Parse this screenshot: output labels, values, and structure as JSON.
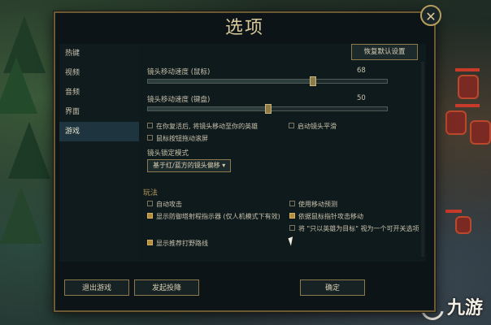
{
  "dialog": {
    "title": "选项",
    "close_symbol": "✕",
    "restore_defaults": "恢复默认设置"
  },
  "sidebar": {
    "items": [
      {
        "label": "热键",
        "active": false
      },
      {
        "label": "视频",
        "active": false
      },
      {
        "label": "音频",
        "active": false
      },
      {
        "label": "界面",
        "active": false
      },
      {
        "label": "游戏",
        "active": true
      }
    ]
  },
  "camera": {
    "mouse_speed": {
      "label": "镜头移动速度 (鼠标)",
      "value": "68"
    },
    "keyboard_speed": {
      "label": "镜头移动速度 (键盘)",
      "value": "50"
    },
    "options": [
      {
        "label": "在你复活后, 将镜头移动至你的英雄",
        "checked": false
      },
      {
        "label": "启动镜头平滑",
        "checked": false
      },
      {
        "label": "鼠标按钮拖动滚屏",
        "checked": false
      }
    ],
    "lock_mode_label": "镜头锁定模式",
    "lock_mode_value": "基于红/蓝方的镜头偏移",
    "lock_mode_caret": "▾"
  },
  "gameplay": {
    "title": "玩法",
    "left": [
      {
        "label": "自动攻击",
        "checked": false
      },
      {
        "label": "显示防御塔射程指示器 (仅人机模式下有效)",
        "checked": true
      },
      {
        "label": "显示推荐打野路线",
        "checked": true
      }
    ],
    "right": [
      {
        "label": "使用移动预测",
        "checked": false
      },
      {
        "label": "依据鼠标指针攻击移动",
        "checked": true
      },
      {
        "label": "将 \"只以英雄为目标\" 视为一个可开关选项",
        "checked": false
      }
    ]
  },
  "footer": {
    "exit": "退出游戏",
    "surrender": "发起投降",
    "ok": "确定"
  },
  "watermark": "九游",
  "colors": {
    "accent": "#b79d5c",
    "checked": "#b68c3a"
  }
}
